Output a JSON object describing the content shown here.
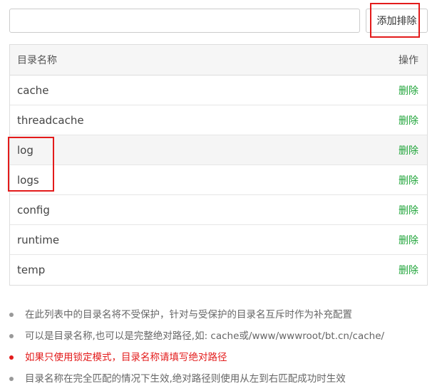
{
  "toolbar": {
    "input_value": "",
    "add_button_label": "添加排除"
  },
  "table": {
    "headers": {
      "name": "目录名称",
      "action": "操作"
    },
    "rows": [
      {
        "name": "cache",
        "action": "删除"
      },
      {
        "name": "threadcache",
        "action": "删除"
      },
      {
        "name": "log",
        "action": "删除"
      },
      {
        "name": "logs",
        "action": "删除"
      },
      {
        "name": "config",
        "action": "删除"
      },
      {
        "name": "runtime",
        "action": "删除"
      },
      {
        "name": "temp",
        "action": "删除"
      }
    ]
  },
  "notes": [
    {
      "text": "在此列表中的目录名将不受保护，针对与受保护的目录名互斥时作为补充配置",
      "warning": false
    },
    {
      "text": "可以是目录名称,也可以是完整绝对路径,如: cache或/www/wwwroot/bt.cn/cache/",
      "warning": false
    },
    {
      "text": "如果只使用锁定模式，目录名称请填写绝对路径",
      "warning": true
    },
    {
      "text": "目录名称在完全匹配的情况下生效,绝对路径则使用从左到右匹配成功时生效",
      "warning": false
    }
  ],
  "colors": {
    "accent_green": "#20a53a",
    "highlight_red": "#e31b1b"
  }
}
